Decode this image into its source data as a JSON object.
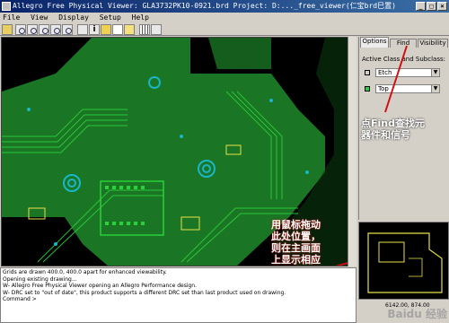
{
  "window": {
    "title": "Allegro Free Physical Viewer: GLA3732PK10-0921.brd  Project: D:..._free_viewer(仁宝brd巳置)"
  },
  "menu": {
    "items": [
      "File",
      "View",
      "Display",
      "Setup",
      "Help"
    ]
  },
  "toolbar": {
    "buttons": [
      "open-icon",
      "zoom-fit-icon",
      "zoom-in-icon",
      "zoom-out-icon",
      "zoom-world-icon",
      "zoom-previous-icon",
      "select-icon",
      "info-icon",
      "color-icon",
      "highlight-icon",
      "dehighlight-icon",
      "grid-icon",
      "measure-icon"
    ]
  },
  "panel": {
    "tabs": [
      "Options",
      "Find",
      "Visibility"
    ],
    "active_tab": "Options",
    "subclass_label": "Active Class and Subclass:",
    "class_value": "Etch",
    "subclass_value": "Top"
  },
  "annotations": {
    "find_note": "点Find查找元\n器件和信号",
    "drag_note": "用鼠标拖动\n此处位置，\n则在主画面\n上显示相应\n的位置"
  },
  "log": {
    "lines": [
      "Grids are drawn 400.0, 400.0 apart for enhanced viewability.",
      "Opening existing drawing...",
      "W- Allegro Free Physical Viewer opening an Allegro Performance design.",
      "W- DRC set to \"out of date\", this product supports a different DRC set than last product used on drawing.",
      "Command >"
    ]
  },
  "status": {
    "coordinates": "6142.00, 874.00"
  },
  "watermark": "Baidu 经验",
  "colors": {
    "board_green": "#1f8a2a",
    "trace_green": "#2bd13a",
    "via_cyan": "#18b6c8",
    "outline_yellow": "#e8e04a",
    "titlebar": "#0a246a",
    "annotation_arrow": "#d01010"
  }
}
